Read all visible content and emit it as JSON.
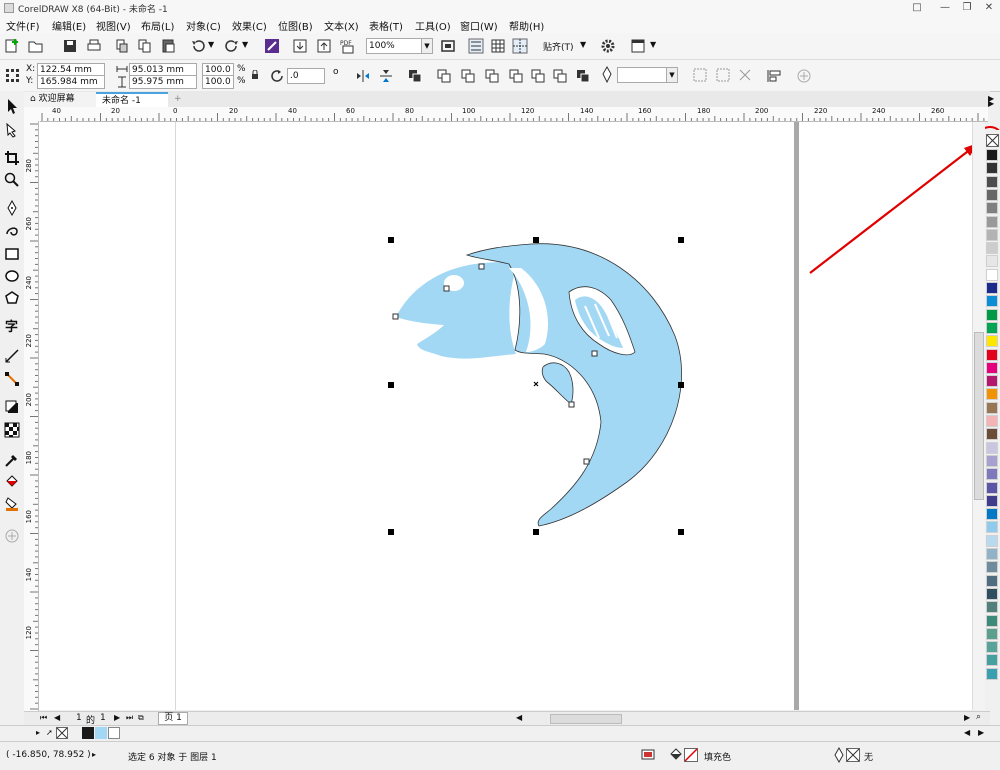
{
  "title": "CorelDRAW X8 (64-Bit) - 未命名 -1",
  "menu": [
    "文件(F)",
    "编辑(E)",
    "视图(V)",
    "布局(L)",
    "对象(C)",
    "效果(C)",
    "位图(B)",
    "文本(X)",
    "表格(T)",
    "工具(O)",
    "窗口(W)",
    "帮助(H)"
  ],
  "toolbar": {
    "zoom_value": "100%",
    "snap_label": "贴齐(T)"
  },
  "property_bar": {
    "x_label": "X:",
    "x_value": "122.54 mm",
    "y_label": "Y:",
    "y_value": "165.984 mm",
    "w_value": "95.013 mm",
    "h_value": "95.975 mm",
    "sx_value": "100.0",
    "sy_value": "100.0",
    "percent": "%",
    "rotation_value": ".0"
  },
  "tabs": {
    "welcome": "欢迎屏幕",
    "doc": "未命名 -1"
  },
  "rulers": {
    "h_ticks": [
      "40",
      "20",
      "0",
      "20",
      "40",
      "60",
      "80",
      "100",
      "120",
      "140",
      "160",
      "180",
      "200",
      "220",
      "240",
      "260"
    ],
    "v_ticks": [
      "280",
      "260",
      "240",
      "220",
      "200",
      "180",
      "160",
      "140",
      "120"
    ]
  },
  "page_nav": {
    "current": "1",
    "of": "的",
    "total": "1",
    "page_tab": "页 1"
  },
  "status": {
    "coords": "( -16.850, 78.952 )",
    "selection": "选定 6 对象 于 图层 1",
    "fill": "填充色",
    "outline": "无"
  },
  "colors": {
    "fish": "#a3d8f4",
    "accent": "#e00000",
    "palette": [
      "#1a1a1a",
      "#333333",
      "#4d4d4d",
      "#666666",
      "#808080",
      "#999999",
      "#b3b3b3",
      "#cccccc",
      "#e6e6e6",
      "#ffffff",
      "#1b2a8c",
      "#0a8fd6",
      "#009a44",
      "#00a651",
      "#ffe600",
      "#e2001a",
      "#e5007e",
      "#b3186d",
      "#f39200",
      "#987554",
      "#f5b3b6",
      "#6b4c36",
      "#c9c6e3",
      "#a6a1d1",
      "#7e78bd",
      "#5b57a5",
      "#403d8c",
      "#0078c8",
      "#8fcbec",
      "#b8d9ef",
      "#91b3c7",
      "#6f8c9e",
      "#4f6d80",
      "#2f4e60",
      "#52807a",
      "#3b8a7a",
      "#5c9f8d",
      "#5aa39a",
      "#46a0a0",
      "#3aa0b0"
    ]
  }
}
